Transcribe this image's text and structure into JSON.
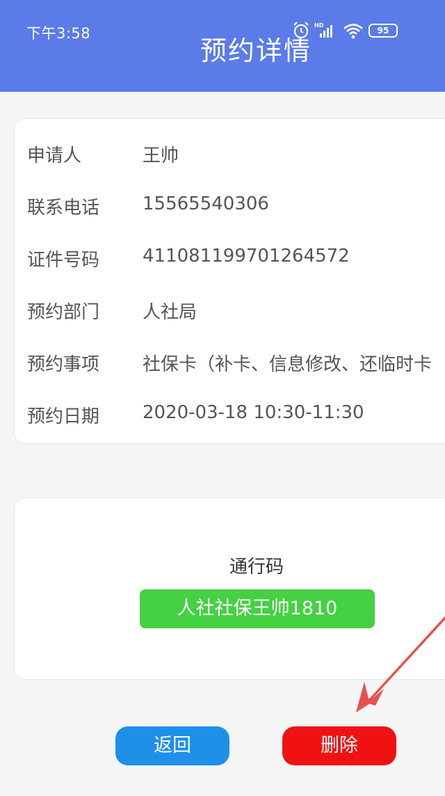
{
  "status_bar": {
    "time": "下午3:58",
    "battery": "95",
    "icons": [
      "alarm-icon",
      "hd-signal-icon",
      "wifi-icon",
      "battery-icon"
    ]
  },
  "header": {
    "title": "预约详情",
    "background_color": "#5b7be8"
  },
  "details": [
    {
      "label": "申请人",
      "value": "王帅"
    },
    {
      "label": "联系电话",
      "value": "15565540306"
    },
    {
      "label": "证件号码",
      "value": "411081199701264572"
    },
    {
      "label": "预约部门",
      "value": "人社局"
    },
    {
      "label": "预约事项",
      "value": "社保卡（补卡、信息修改、还临时卡"
    },
    {
      "label": "预约日期",
      "value": "2020-03-18  10:30-11:30"
    }
  ],
  "pass": {
    "title": "通行码",
    "code": "人社社保王帅1810",
    "color": "#44d142"
  },
  "actions": {
    "back_label": "返回",
    "delete_label": "删除",
    "back_color": "#1e90e8",
    "delete_color": "#f01212"
  },
  "annotation": {
    "arrow_color": "#e8504f"
  }
}
